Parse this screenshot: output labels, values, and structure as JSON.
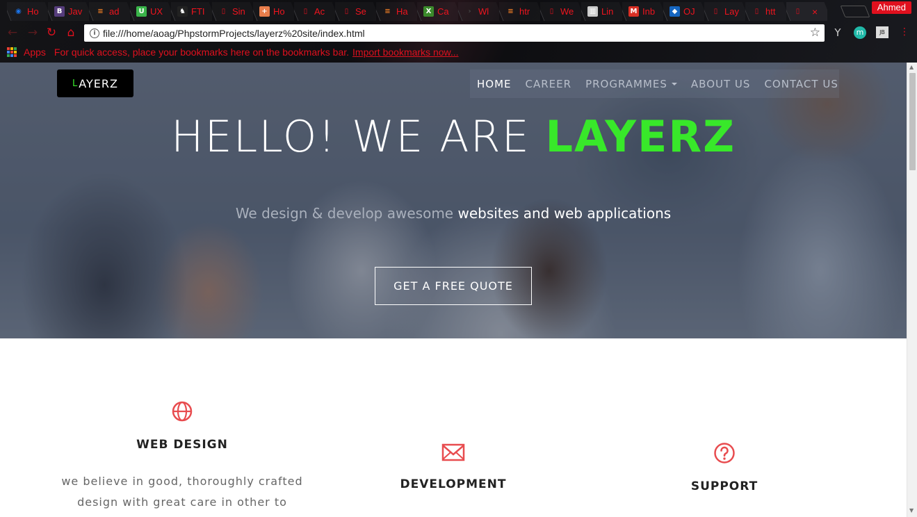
{
  "browser": {
    "tabs": [
      {
        "label": "Ho",
        "icon": "chrome-icon",
        "color": "#1a73e8"
      },
      {
        "label": "Jav",
        "icon": "bootstrap-icon",
        "color": "#563d7c"
      },
      {
        "label": "ad",
        "icon": "stackoverflow-icon",
        "color": "#f48024"
      },
      {
        "label": "UX",
        "icon": "u-icon",
        "color": "#3ab54a"
      },
      {
        "label": "FTI",
        "icon": "bull-icon",
        "color": "#222"
      },
      {
        "label": "Sin",
        "icon": "page-icon",
        "color": "#e0101e"
      },
      {
        "label": "Ho",
        "icon": "plus-icon",
        "color": "#e87d4b"
      },
      {
        "label": "Ac",
        "icon": "page-icon",
        "color": "#e0101e"
      },
      {
        "label": "Se",
        "icon": "page-icon",
        "color": "#e0101e"
      },
      {
        "label": "Ha",
        "icon": "stackoverflow-icon",
        "color": "#f48024"
      },
      {
        "label": "Ca",
        "icon": "x-icon",
        "color": "#3b8a2b"
      },
      {
        "label": "Wl",
        "icon": "code-icon",
        "color": "#444"
      },
      {
        "label": "htr",
        "icon": "stackoverflow-icon",
        "color": "#f48024"
      },
      {
        "label": "We",
        "icon": "page-icon",
        "color": "#e0101e"
      },
      {
        "label": "Lin",
        "icon": "book-icon",
        "color": "#ccc"
      },
      {
        "label": "Inb",
        "icon": "gmail-icon",
        "color": "#d93025"
      },
      {
        "label": "OJ",
        "icon": "shield-icon",
        "color": "#1565c0"
      },
      {
        "label": "Lay",
        "icon": "page-icon",
        "color": "#e0101e"
      },
      {
        "label": "htt",
        "icon": "page-icon",
        "color": "#e0101e"
      },
      {
        "label": "",
        "icon": "page-icon",
        "color": "#e0101e",
        "active": true
      }
    ],
    "tab_close": "×",
    "profile_name": "Ahmed",
    "url": "file:///home/aoag/PhpstormProjects/layerz%20site/index.html",
    "bookmarks": {
      "apps_label": "Apps",
      "hint": "For quick access, place your bookmarks here on the bookmarks bar.",
      "import_link": "Import bookmarks now..."
    },
    "extensions": [
      "Y",
      "m",
      "JB"
    ]
  },
  "site": {
    "logo_text": "AYERZ",
    "logo_prefix": "L",
    "nav": [
      {
        "label": "HOME",
        "active": true
      },
      {
        "label": "CAREER"
      },
      {
        "label": "PROGRAMMES",
        "dropdown": true
      },
      {
        "label": "ABOUT US"
      },
      {
        "label": "CONTACT US"
      }
    ],
    "hero": {
      "title_prefix": "HELLO! WE ARE ",
      "title_brand": "LAYERZ",
      "subtitle_muted": "We design & develop awesome ",
      "subtitle_highlight": "websites and web applications",
      "cta": "GET A FREE QUOTE"
    },
    "features": [
      {
        "title": "WEB DESIGN",
        "icon": "globe-icon",
        "text": [
          "we believe in good, thoroughly crafted",
          "design with great care in other to achieve"
        ]
      },
      {
        "title": "DEVELOPMENT",
        "icon": "envelope-icon",
        "text": []
      },
      {
        "title": "SUPPORT",
        "icon": "question-icon",
        "text": []
      }
    ],
    "accent_color": "#e84c4f",
    "brand_green": "#38e82a"
  }
}
